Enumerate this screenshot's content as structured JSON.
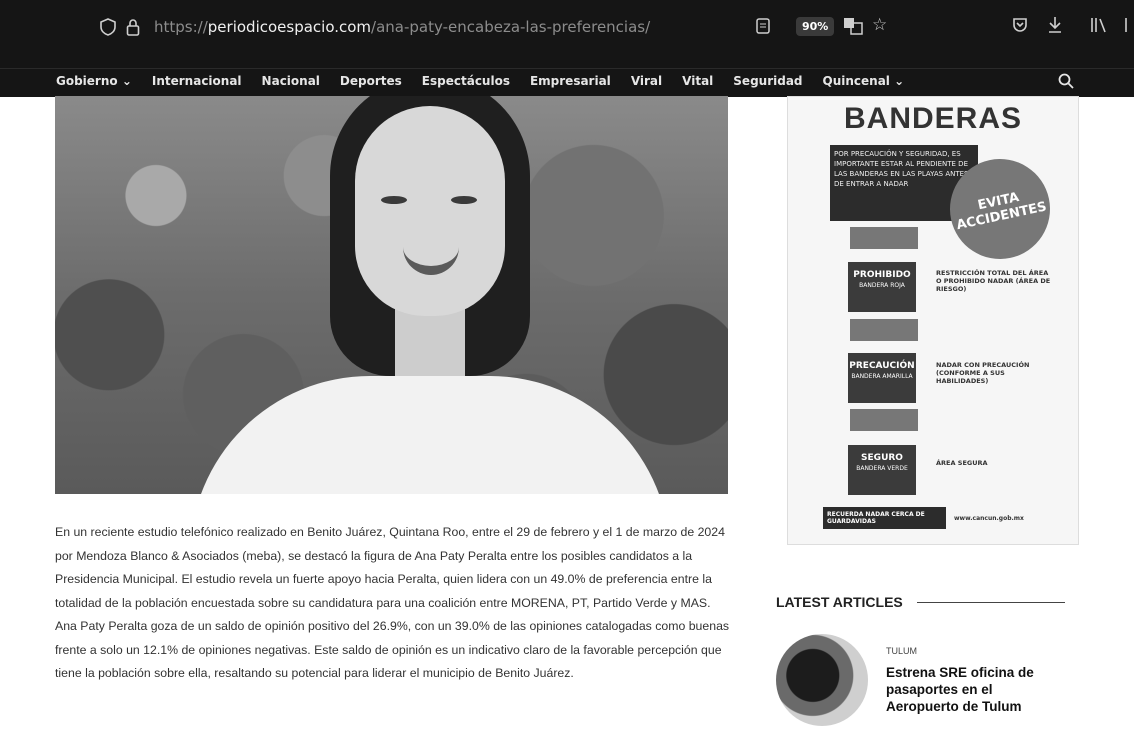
{
  "browser": {
    "url_protocol": "https://",
    "url_domain": "periodicoespacio.com",
    "url_path": "/ana-paty-encabeza-las-preferencias/",
    "zoom": "90%"
  },
  "nav": {
    "items": [
      "Gobierno ⌄",
      "Internacional",
      "Nacional",
      "Deportes",
      "Espectáculos",
      "Empresarial",
      "Viral",
      "Vital",
      "Seguridad",
      "Quincenal ⌄"
    ]
  },
  "article": {
    "paragraphs": [
      "En un reciente estudio telefónico realizado en Benito Juárez, Quintana Roo, entre el 29 de febrero y el 1 de marzo de 2024 por Mendoza Blanco & Asociados (meba), se destacó la figura de Ana Paty Peralta entre los posibles candidatos a la Presidencia Municipal. El estudio revela un fuerte apoyo hacia Peralta, quien lidera con un 49.0% de preferencia entre la totalidad de la población encuestada sobre su candidatura para una coalición entre MORENA, PT, Partido Verde y MAS.",
      "Ana Paty Peralta goza de un saldo de opinión positivo del 26.9%, con un 39.0% de las opiniones catalogadas como buenas frente a solo un 12.1% de opiniones negativas. Este saldo de opinión es un indicativo claro de la favorable percepción que tiene la población sobre ella, resaltando su potencial para liderar el municipio de Benito Juárez."
    ]
  },
  "ad": {
    "title": "BANDERAS",
    "intro": "POR PRECAUCIÓN Y SEGURIDAD, ES IMPORTANTE ESTAR AL PENDIENTE DE LAS BANDERAS EN LAS PLAYAS ANTES DE ENTRAR A NADAR",
    "badge": "EVITA ACCIDENTES",
    "rows": [
      {
        "label": "PROHIBIDO",
        "sub": "BANDERA ROJA",
        "desc": "RESTRICCIÓN TOTAL DEL ÁREA O PROHIBIDO NADAR (ÁREA DE RIESGO)"
      },
      {
        "label": "PRECAUCIÓN",
        "sub": "BANDERA AMARILLA",
        "desc": "NADAR CON PRECAUCIÓN (CONFORME A SUS HABILIDADES)"
      },
      {
        "label": "SEGURO",
        "sub": "BANDERA VERDE",
        "desc": "ÁREA SEGURA"
      }
    ],
    "footer_remember": "RECUERDA NADAR CERCA DE GUARDAVIDAS",
    "footer_site": "www.cancun.gob.mx"
  },
  "sidebar": {
    "latest_title": "LATEST ARTICLES",
    "article_category": "TULUM",
    "article_title": "Estrena SRE oficina de pasaportes en el Aeropuerto de Tulum"
  }
}
